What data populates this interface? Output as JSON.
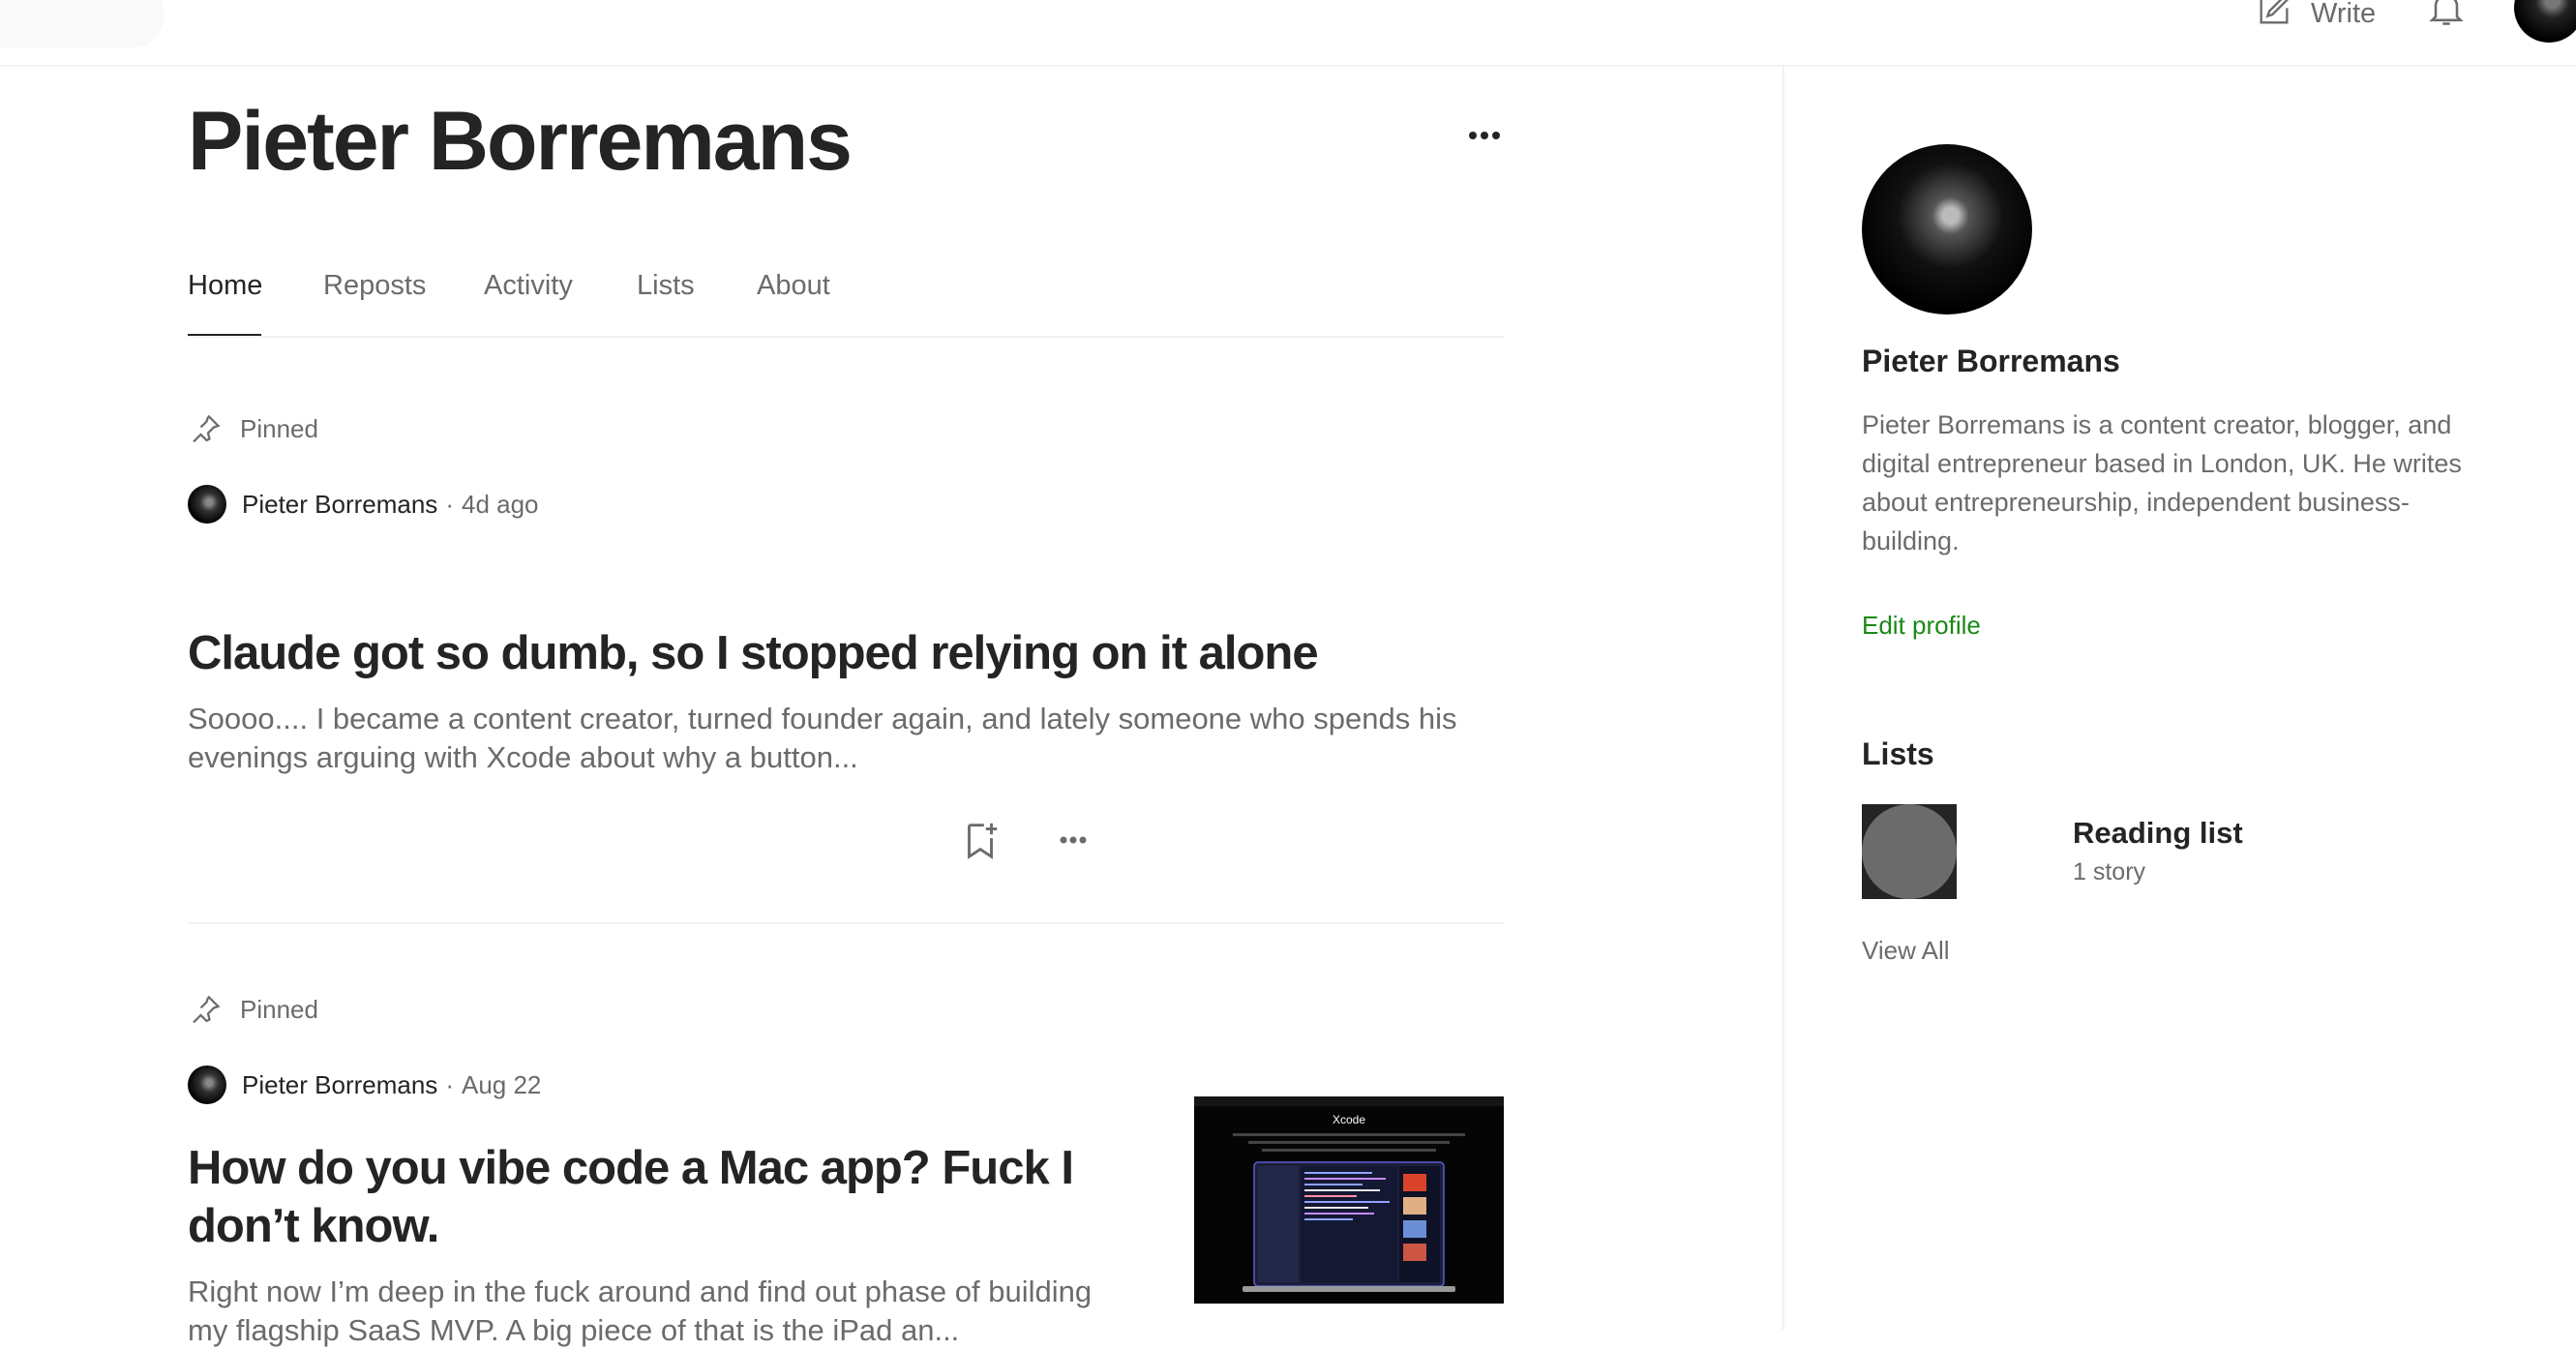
{
  "topbar": {
    "write_label": "Write",
    "icons": {
      "write": "pencil-square-icon",
      "notifications": "bell-icon",
      "avatar": "user-avatar"
    }
  },
  "profile": {
    "name": "Pieter Borremans",
    "tabs": [
      {
        "label": "Home",
        "active": true
      },
      {
        "label": "Reposts",
        "active": false
      },
      {
        "label": "Activity",
        "active": false
      },
      {
        "label": "Lists",
        "active": false
      },
      {
        "label": "About",
        "active": false
      }
    ]
  },
  "posts": [
    {
      "pinned_label": "Pinned",
      "author": "Pieter Borremans",
      "separator": "·",
      "date": "4d ago",
      "title": "Claude got so dumb, so I stopped relying on it alone",
      "excerpt": "Soooo.... I became a content creator, turned founder again, and lately someone who spends his evenings arguing with Xcode about why a button..."
    },
    {
      "pinned_label": "Pinned",
      "author": "Pieter Borremans",
      "separator": "·",
      "date": "Aug 22",
      "title": "How do you vibe code a Mac app? Fuck I don’t know.",
      "excerpt": "Right now I’m deep in the fuck around and find out phase of building my flagship SaaS MVP. A big piece of that is the iPad an...",
      "thumbnail_title": "Xcode"
    }
  ],
  "sidebar": {
    "name": "Pieter Borremans",
    "bio": "Pieter Borremans is a content creator, blogger, and digital entrepreneur based in London, UK. He writes about entrepreneurship, independent business-building.",
    "edit_profile": "Edit profile",
    "lists_title": "Lists",
    "lists": [
      {
        "name": "Reading list",
        "count": "1 story"
      }
    ],
    "view_all": "View All"
  },
  "colors": {
    "accent_green": "#1a8917",
    "text_primary": "#242424",
    "text_secondary": "#6b6b6b",
    "divider": "#f2f2f2"
  }
}
